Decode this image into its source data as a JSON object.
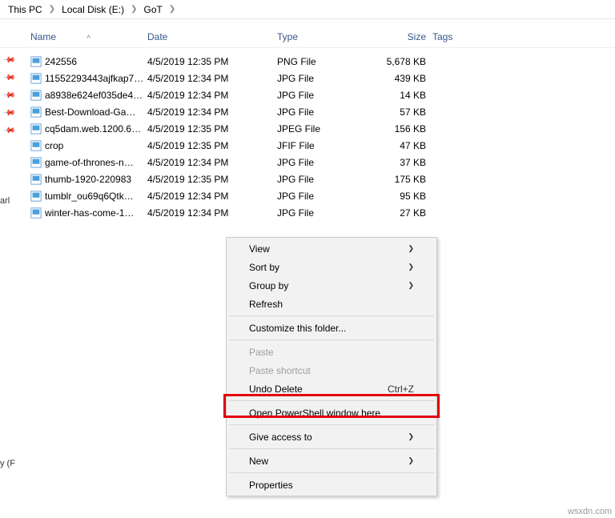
{
  "breadcrumb": {
    "items": [
      "This PC",
      "Local Disk (E:)",
      "GoT"
    ]
  },
  "columns": {
    "name": "Name",
    "date": "Date",
    "type": "Type",
    "size": "Size",
    "tags": "Tags"
  },
  "files": [
    {
      "name": "242556",
      "date": "4/5/2019 12:35 PM",
      "type": "PNG File",
      "size": "5,678 KB"
    },
    {
      "name": "11552293443ajfkap7…",
      "date": "4/5/2019 12:34 PM",
      "type": "JPG File",
      "size": "439 KB"
    },
    {
      "name": "a8938e624ef035de4…",
      "date": "4/5/2019 12:34 PM",
      "type": "JPG File",
      "size": "14 KB"
    },
    {
      "name": "Best-Download-Ga…",
      "date": "4/5/2019 12:34 PM",
      "type": "JPG File",
      "size": "57 KB"
    },
    {
      "name": "cq5dam.web.1200.6…",
      "date": "4/5/2019 12:35 PM",
      "type": "JPEG File",
      "size": "156 KB"
    },
    {
      "name": "crop",
      "date": "4/5/2019 12:35 PM",
      "type": "JFIF File",
      "size": "47 KB"
    },
    {
      "name": "game-of-thrones-n…",
      "date": "4/5/2019 12:34 PM",
      "type": "JPG File",
      "size": "37 KB"
    },
    {
      "name": "thumb-1920-220983",
      "date": "4/5/2019 12:35 PM",
      "type": "JPG File",
      "size": "175 KB"
    },
    {
      "name": "tumblr_ou69q6Qtk…",
      "date": "4/5/2019 12:34 PM",
      "type": "JPG File",
      "size": "95 KB"
    },
    {
      "name": "winter-has-come-1…",
      "date": "4/5/2019 12:34 PM",
      "type": "JPG File",
      "size": "27 KB"
    }
  ],
  "context_menu": {
    "view": "View",
    "sort_by": "Sort by",
    "group_by": "Group by",
    "refresh": "Refresh",
    "customize": "Customize this folder...",
    "paste": "Paste",
    "paste_shortcut": "Paste shortcut",
    "undo_delete": "Undo Delete",
    "undo_shortcut": "Ctrl+Z",
    "open_powershell": "Open PowerShell window here",
    "give_access": "Give access to",
    "new": "New",
    "properties": "Properties"
  },
  "leftnav_fragments": {
    "a": "arl",
    "b": "y (F"
  },
  "watermark": "wsxdn.com"
}
